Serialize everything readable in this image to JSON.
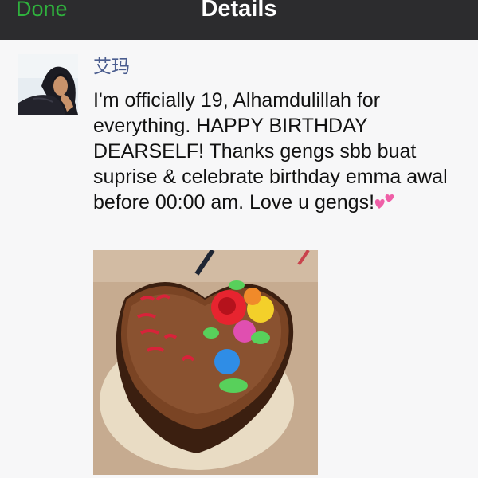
{
  "nav": {
    "back_label": "Done",
    "title": "Details"
  },
  "post": {
    "author": "艾玛",
    "text": "I'm officially 19, Alhamdulillah for everything. HAPPY BIRTHDAY DEARSELF! Thanks gengs sbb buat suprise & celebrate birthday emma awal before 00:00 am. Love u gengs!",
    "emoji": "two-hearts-icon"
  },
  "colors": {
    "navbar": "#2c2c2e",
    "done_green": "#2fb23d",
    "author_blue": "#4b5d8f",
    "background": "#f7f7f8"
  }
}
